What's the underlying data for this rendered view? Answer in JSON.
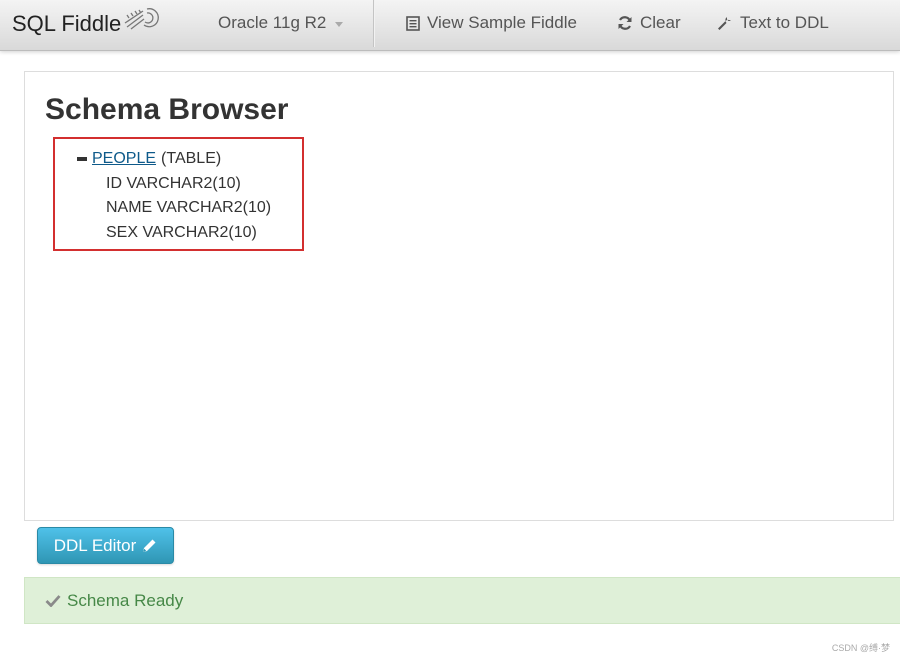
{
  "navbar": {
    "brand": "SQL Fiddle",
    "database": "Oracle 11g R2",
    "view_sample": "View Sample Fiddle",
    "clear": "Clear",
    "text_to_ddl": "Text to DDL"
  },
  "schema_browser": {
    "title": "Schema Browser",
    "tables": [
      {
        "name": "PEOPLE",
        "kind": "(TABLE)",
        "columns": [
          "ID VARCHAR2(10)",
          "NAME VARCHAR2(10)",
          "SEX VARCHAR2(10)"
        ]
      }
    ]
  },
  "ddl_button": {
    "label": "DDL Editor"
  },
  "status": {
    "message": "Schema Ready"
  },
  "watermark": "CSDN @缚·梦",
  "colors": {
    "link": "#0e5a8a",
    "highlight_box": "#d32f2f",
    "button": "#2f96b4",
    "status_bg": "#dff0d8",
    "status_text": "#468847"
  },
  "icons": {
    "brand_logo": "shell-icon",
    "database_caret": "caret-down-icon",
    "view_sample": "list-icon",
    "clear": "refresh-icon",
    "text_to_ddl": "wrench-icon",
    "collapse": "minus-icon",
    "ddl_button": "pencil-icon",
    "status": "check-icon"
  }
}
